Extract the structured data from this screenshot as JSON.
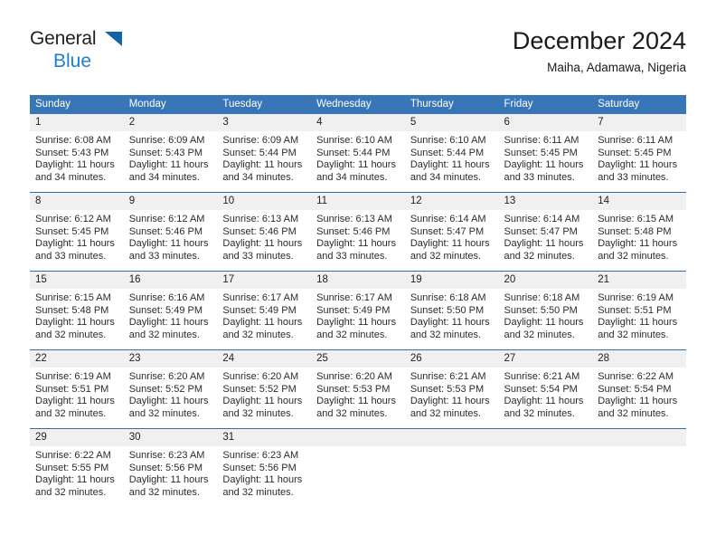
{
  "brand": {
    "word_one": "General",
    "word_two": "Blue",
    "triangle_icon": "triangle-logo-icon",
    "colors": {
      "general_text": "#231f20",
      "blue_text": "#1c7fd0",
      "triangle": "#1365a8"
    }
  },
  "header": {
    "title": "December 2024",
    "subtitle": "Maiha, Adamawa, Nigeria"
  },
  "theme": {
    "header_row_bg": "#3876b8",
    "header_row_text": "#ffffff",
    "daynum_bg": "#f0f0f0",
    "row_divider": "#2f6fae",
    "body_text": "#2b2b2b"
  },
  "weekday_headers": [
    "Sunday",
    "Monday",
    "Tuesday",
    "Wednesday",
    "Thursday",
    "Friday",
    "Saturday"
  ],
  "weeks": [
    [
      {
        "day": "1",
        "sunrise": "Sunrise: 6:08 AM",
        "sunset": "Sunset: 5:43 PM",
        "daylight": "Daylight: 11 hours and 34 minutes."
      },
      {
        "day": "2",
        "sunrise": "Sunrise: 6:09 AM",
        "sunset": "Sunset: 5:43 PM",
        "daylight": "Daylight: 11 hours and 34 minutes."
      },
      {
        "day": "3",
        "sunrise": "Sunrise: 6:09 AM",
        "sunset": "Sunset: 5:44 PM",
        "daylight": "Daylight: 11 hours and 34 minutes."
      },
      {
        "day": "4",
        "sunrise": "Sunrise: 6:10 AM",
        "sunset": "Sunset: 5:44 PM",
        "daylight": "Daylight: 11 hours and 34 minutes."
      },
      {
        "day": "5",
        "sunrise": "Sunrise: 6:10 AM",
        "sunset": "Sunset: 5:44 PM",
        "daylight": "Daylight: 11 hours and 34 minutes."
      },
      {
        "day": "6",
        "sunrise": "Sunrise: 6:11 AM",
        "sunset": "Sunset: 5:45 PM",
        "daylight": "Daylight: 11 hours and 33 minutes."
      },
      {
        "day": "7",
        "sunrise": "Sunrise: 6:11 AM",
        "sunset": "Sunset: 5:45 PM",
        "daylight": "Daylight: 11 hours and 33 minutes."
      }
    ],
    [
      {
        "day": "8",
        "sunrise": "Sunrise: 6:12 AM",
        "sunset": "Sunset: 5:45 PM",
        "daylight": "Daylight: 11 hours and 33 minutes."
      },
      {
        "day": "9",
        "sunrise": "Sunrise: 6:12 AM",
        "sunset": "Sunset: 5:46 PM",
        "daylight": "Daylight: 11 hours and 33 minutes."
      },
      {
        "day": "10",
        "sunrise": "Sunrise: 6:13 AM",
        "sunset": "Sunset: 5:46 PM",
        "daylight": "Daylight: 11 hours and 33 minutes."
      },
      {
        "day": "11",
        "sunrise": "Sunrise: 6:13 AM",
        "sunset": "Sunset: 5:46 PM",
        "daylight": "Daylight: 11 hours and 33 minutes."
      },
      {
        "day": "12",
        "sunrise": "Sunrise: 6:14 AM",
        "sunset": "Sunset: 5:47 PM",
        "daylight": "Daylight: 11 hours and 32 minutes."
      },
      {
        "day": "13",
        "sunrise": "Sunrise: 6:14 AM",
        "sunset": "Sunset: 5:47 PM",
        "daylight": "Daylight: 11 hours and 32 minutes."
      },
      {
        "day": "14",
        "sunrise": "Sunrise: 6:15 AM",
        "sunset": "Sunset: 5:48 PM",
        "daylight": "Daylight: 11 hours and 32 minutes."
      }
    ],
    [
      {
        "day": "15",
        "sunrise": "Sunrise: 6:15 AM",
        "sunset": "Sunset: 5:48 PM",
        "daylight": "Daylight: 11 hours and 32 minutes."
      },
      {
        "day": "16",
        "sunrise": "Sunrise: 6:16 AM",
        "sunset": "Sunset: 5:49 PM",
        "daylight": "Daylight: 11 hours and 32 minutes."
      },
      {
        "day": "17",
        "sunrise": "Sunrise: 6:17 AM",
        "sunset": "Sunset: 5:49 PM",
        "daylight": "Daylight: 11 hours and 32 minutes."
      },
      {
        "day": "18",
        "sunrise": "Sunrise: 6:17 AM",
        "sunset": "Sunset: 5:49 PM",
        "daylight": "Daylight: 11 hours and 32 minutes."
      },
      {
        "day": "19",
        "sunrise": "Sunrise: 6:18 AM",
        "sunset": "Sunset: 5:50 PM",
        "daylight": "Daylight: 11 hours and 32 minutes."
      },
      {
        "day": "20",
        "sunrise": "Sunrise: 6:18 AM",
        "sunset": "Sunset: 5:50 PM",
        "daylight": "Daylight: 11 hours and 32 minutes."
      },
      {
        "day": "21",
        "sunrise": "Sunrise: 6:19 AM",
        "sunset": "Sunset: 5:51 PM",
        "daylight": "Daylight: 11 hours and 32 minutes."
      }
    ],
    [
      {
        "day": "22",
        "sunrise": "Sunrise: 6:19 AM",
        "sunset": "Sunset: 5:51 PM",
        "daylight": "Daylight: 11 hours and 32 minutes."
      },
      {
        "day": "23",
        "sunrise": "Sunrise: 6:20 AM",
        "sunset": "Sunset: 5:52 PM",
        "daylight": "Daylight: 11 hours and 32 minutes."
      },
      {
        "day": "24",
        "sunrise": "Sunrise: 6:20 AM",
        "sunset": "Sunset: 5:52 PM",
        "daylight": "Daylight: 11 hours and 32 minutes."
      },
      {
        "day": "25",
        "sunrise": "Sunrise: 6:20 AM",
        "sunset": "Sunset: 5:53 PM",
        "daylight": "Daylight: 11 hours and 32 minutes."
      },
      {
        "day": "26",
        "sunrise": "Sunrise: 6:21 AM",
        "sunset": "Sunset: 5:53 PM",
        "daylight": "Daylight: 11 hours and 32 minutes."
      },
      {
        "day": "27",
        "sunrise": "Sunrise: 6:21 AM",
        "sunset": "Sunset: 5:54 PM",
        "daylight": "Daylight: 11 hours and 32 minutes."
      },
      {
        "day": "28",
        "sunrise": "Sunrise: 6:22 AM",
        "sunset": "Sunset: 5:54 PM",
        "daylight": "Daylight: 11 hours and 32 minutes."
      }
    ],
    [
      {
        "day": "29",
        "sunrise": "Sunrise: 6:22 AM",
        "sunset": "Sunset: 5:55 PM",
        "daylight": "Daylight: 11 hours and 32 minutes."
      },
      {
        "day": "30",
        "sunrise": "Sunrise: 6:23 AM",
        "sunset": "Sunset: 5:56 PM",
        "daylight": "Daylight: 11 hours and 32 minutes."
      },
      {
        "day": "31",
        "sunrise": "Sunrise: 6:23 AM",
        "sunset": "Sunset: 5:56 PM",
        "daylight": "Daylight: 11 hours and 32 minutes."
      },
      {
        "day": "",
        "sunrise": "",
        "sunset": "",
        "daylight": ""
      },
      {
        "day": "",
        "sunrise": "",
        "sunset": "",
        "daylight": ""
      },
      {
        "day": "",
        "sunrise": "",
        "sunset": "",
        "daylight": ""
      },
      {
        "day": "",
        "sunrise": "",
        "sunset": "",
        "daylight": ""
      }
    ]
  ]
}
